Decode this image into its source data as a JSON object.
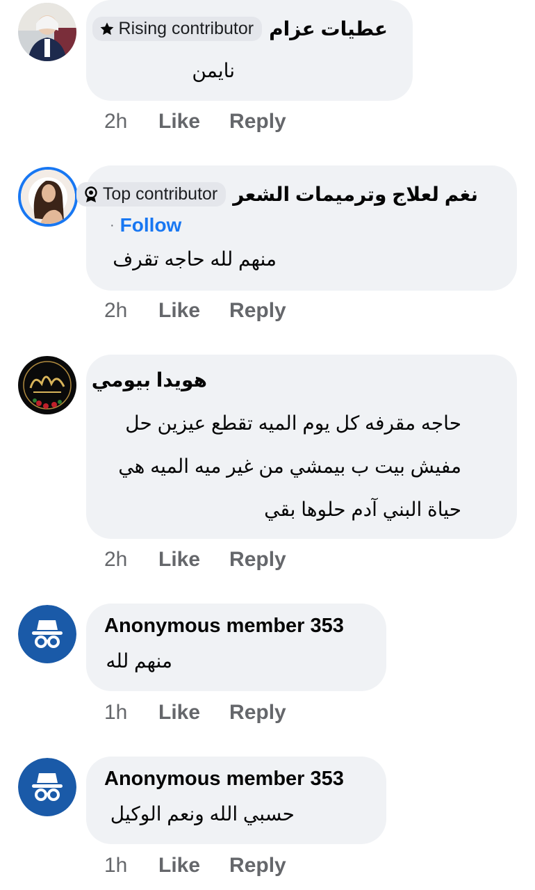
{
  "comments": [
    {
      "author": "عطيات عزام",
      "badge": "Rising contributor",
      "badge_icon": "star-icon",
      "text_lines": [
        "نايمن"
      ],
      "time": "2h",
      "like": "Like",
      "reply": "Reply"
    },
    {
      "author": "نغم لعلاج وترميمات الشعر",
      "badge": "Top contributor",
      "badge_icon": "award-icon",
      "follow_separator": "·",
      "follow": "Follow",
      "text_lines": [
        "منهم لله حاجه تقرف"
      ],
      "time": "2h",
      "like": "Like",
      "reply": "Reply"
    },
    {
      "author": "هويدا بيومي",
      "text_lines": [
        "حاجه مقرفه كل يوم الميه تقطع  عيزين حل",
        "مفيش بيت ب بيمشي من غير ميه الميه هي",
        "حياة البني آدم حلوها بقي"
      ],
      "time": "2h",
      "like": "Like",
      "reply": "Reply"
    },
    {
      "author": "Anonymous member 353",
      "avatar_icon": "anonymous-icon",
      "text_lines": [
        "منهم لله"
      ],
      "time": "1h",
      "like": "Like",
      "reply": "Reply"
    },
    {
      "author": "Anonymous member 353",
      "avatar_icon": "anonymous-icon",
      "text_lines": [
        "حسبي الله ونعم الوكيل"
      ],
      "time": "1h",
      "like": "Like",
      "reply": "Reply"
    }
  ],
  "colors": {
    "bubble": "#f0f2f5",
    "badge": "#e4e6eb",
    "meta_text": "#65676b",
    "follow_link": "#1877f2",
    "anonymous_avatar": "#1a5aa8",
    "avatar_ring": "#1877f2"
  }
}
